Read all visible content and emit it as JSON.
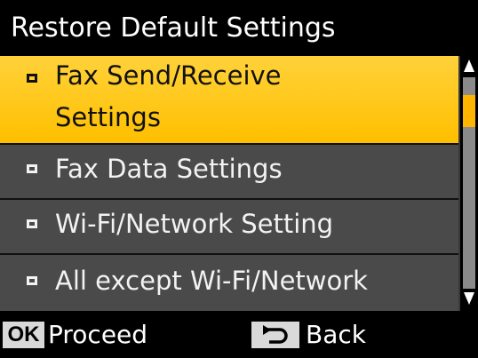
{
  "screen": {
    "title": "Restore Default Settings"
  },
  "menu": {
    "items": [
      {
        "label_line1": "Fax Send/Receive",
        "label_line2": "Settings",
        "selected": true
      },
      {
        "label": "Fax Data Settings",
        "selected": false
      },
      {
        "label": "Wi-Fi/Network Setting",
        "selected": false
      },
      {
        "label": "All except Wi-Fi/Network",
        "selected": false
      }
    ]
  },
  "footer": {
    "ok_key": "OK",
    "proceed_label": "Proceed",
    "back_label": "Back"
  },
  "colors": {
    "selected_bg": "#ffc21a",
    "item_bg": "#4a4a4a",
    "scroll_thumb": "#ffb400"
  },
  "icons": {
    "back_key": "return-arrow-icon",
    "scroll_up": "triangle-up-icon",
    "scroll_down": "triangle-down-icon",
    "bullet": "square-bullet-icon"
  }
}
